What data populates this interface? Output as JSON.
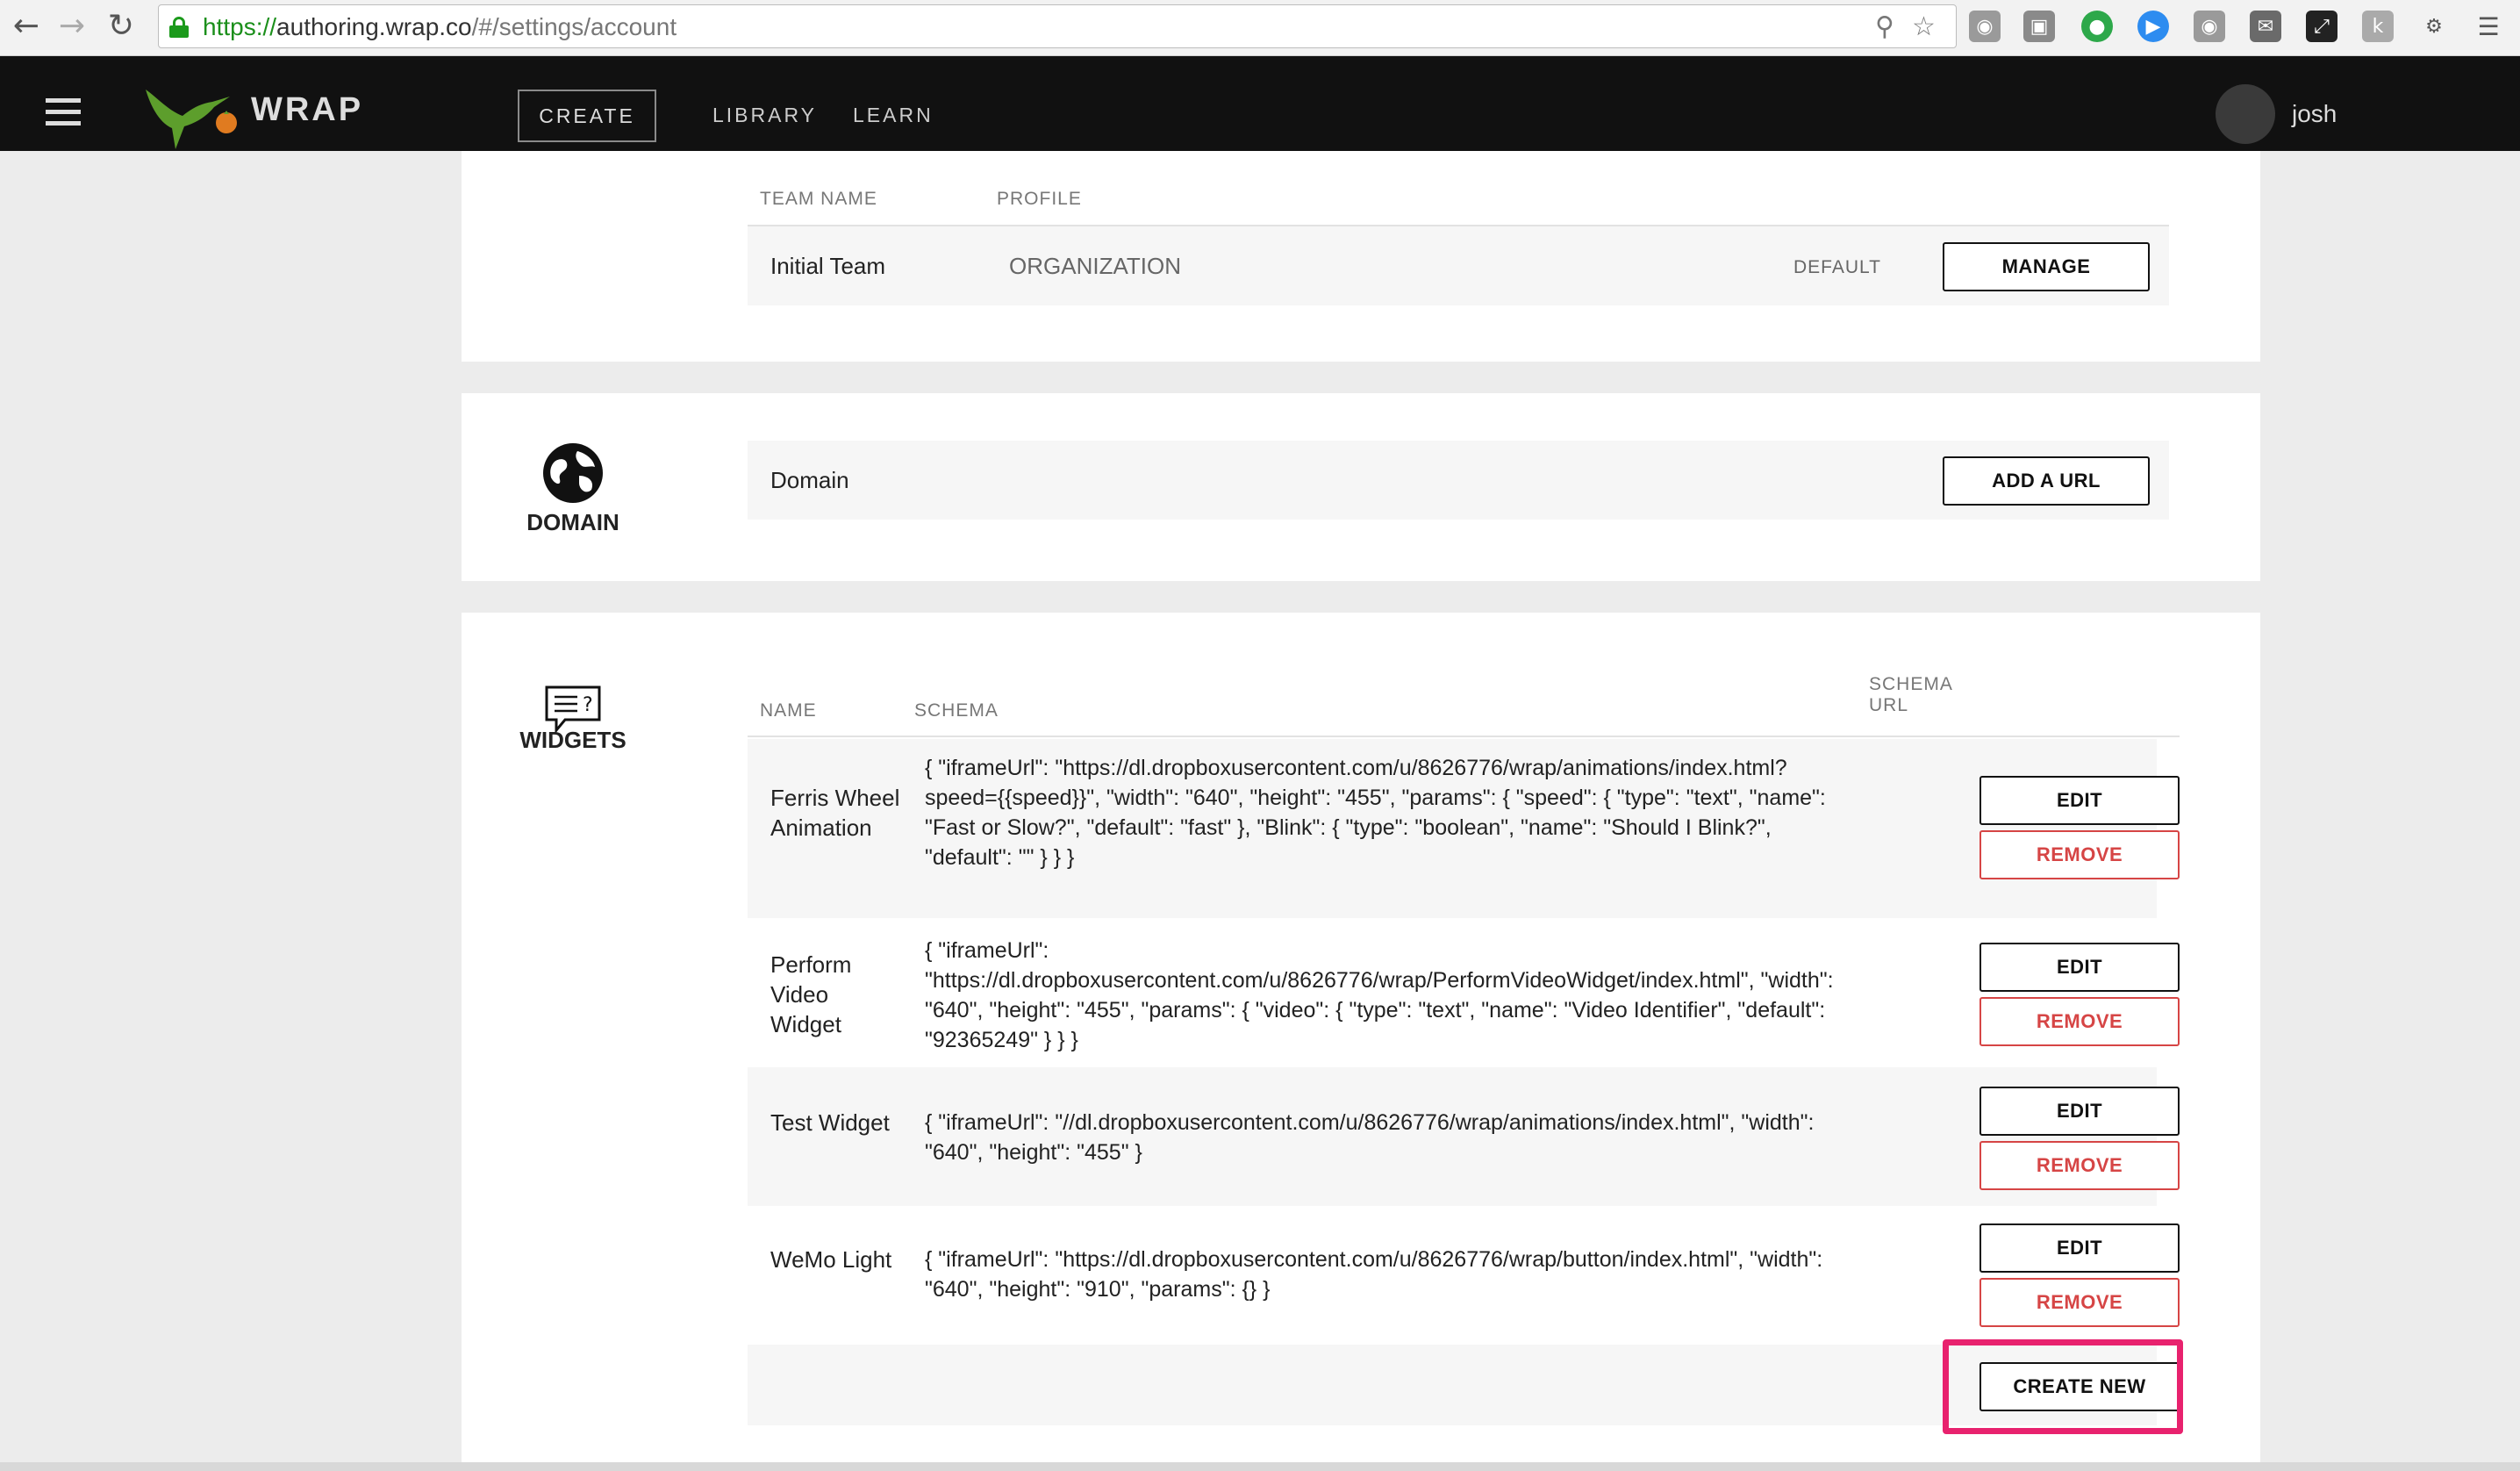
{
  "browser": {
    "url_scheme": "https://",
    "url_host": "authoring.wrap.co",
    "url_path": "/#/settings/account",
    "back_icon": "arrow-left-icon",
    "forward_icon": "arrow-right-icon",
    "reload_icon": "reload-icon"
  },
  "header": {
    "brand": "WRAP",
    "tabs": {
      "create": "CREATE",
      "library": "LIBRARY",
      "learn": "LEARN"
    },
    "user": "josh"
  },
  "team": {
    "col_team_name": "TEAM NAME",
    "col_profile": "PROFILE",
    "rows": [
      {
        "name": "Initial Team",
        "profile": "ORGANIZATION",
        "status": "DEFAULT",
        "action": "MANAGE"
      }
    ]
  },
  "domain": {
    "title": "DOMAIN",
    "row_label": "Domain",
    "action": "ADD A URL"
  },
  "widgets": {
    "title": "WIDGETS",
    "col_name": "NAME",
    "col_schema": "SCHEMA",
    "col_schema_url_1": "SCHEMA",
    "col_schema_url_2": "URL",
    "edit_label": "EDIT",
    "remove_label": "REMOVE",
    "create_new": "CREATE NEW",
    "rows": [
      {
        "name": "Ferris Wheel Animation",
        "schema": "{ \"iframeUrl\": \"https://dl.dropboxusercontent.com/u/8626776/wrap/animations/index.html?speed={{speed}}\", \"width\": \"640\", \"height\": \"455\", \"params\": { \"speed\": { \"type\": \"text\", \"name\": \"Fast or Slow?\", \"default\": \"fast\" }, \"Blink\": { \"type\": \"boolean\", \"name\": \"Should I Blink?\", \"default\": \"\" } } }"
      },
      {
        "name": "Perform Video Widget",
        "schema": "{ \"iframeUrl\": \"https://dl.dropboxusercontent.com/u/8626776/wrap/PerformVideoWidget/index.html\", \"width\": \"640\", \"height\": \"455\", \"params\": { \"video\": { \"type\": \"text\", \"name\": \"Video Identifier\", \"default\": \"92365249\" } } }"
      },
      {
        "name": "Test Widget",
        "schema": "{ \"iframeUrl\": \"//dl.dropboxusercontent.com/u/8626776/wrap/animations/index.html\", \"width\": \"640\", \"height\": \"455\" }"
      },
      {
        "name": "WeMo Light",
        "schema": "{ \"iframeUrl\": \"https://dl.dropboxusercontent.com/u/8626776/wrap/button/index.html\", \"width\": \"640\", \"height\": \"910\", \"params\": {} }"
      }
    ]
  },
  "colors": {
    "highlight": "#e8226e",
    "remove": "#d64545",
    "url_green": "#1b8f1b"
  }
}
